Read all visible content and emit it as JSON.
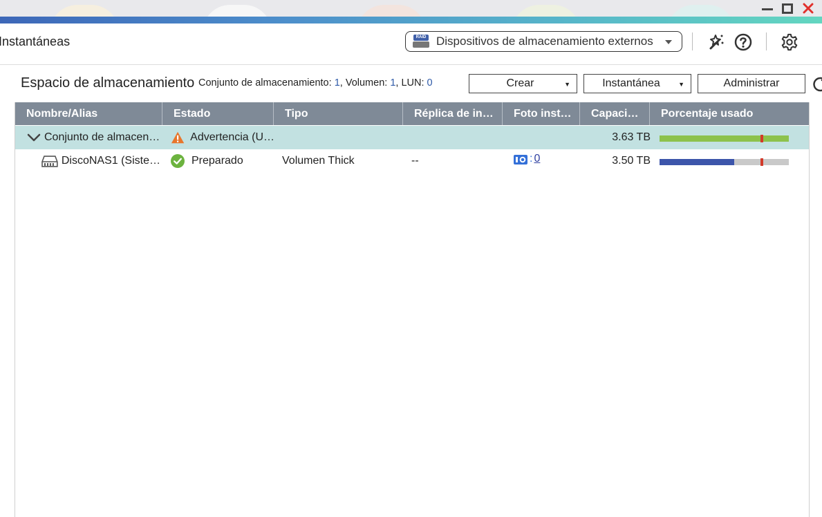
{
  "window": {
    "title": "Instantáneas",
    "controls": [
      "minimize-icon",
      "maximize-icon",
      "close-icon"
    ]
  },
  "header": {
    "device_button_label": "Dispositivos de almacenamiento externos",
    "device_icon_badge": "RAID",
    "icons": [
      "magic-wand-icon",
      "help-icon",
      "gear-icon"
    ]
  },
  "storage": {
    "title": "Espacio de almacenamiento",
    "pool_label": "Conjunto de almacenamiento:",
    "pool_count": "1",
    "volume_label": "Volumen:",
    "volume_count": "1",
    "lun_label": "LUN:",
    "lun_count": "0",
    "buttons": {
      "create": "Crear",
      "snapshot": "Instantánea",
      "manage": "Administrar"
    }
  },
  "table": {
    "columns": [
      "Nombre/Alias",
      "Estado",
      "Tipo",
      "Réplica de in…",
      "Foto inst…",
      "Capaci…",
      "Porcentaje usado"
    ],
    "rows": [
      {
        "name": "Conjunto de almacen…",
        "status": "Advertencia (U…",
        "type": "",
        "replica": "",
        "snapshot": "",
        "capacity": "3.63 TB",
        "usage_percent": 100,
        "threshold_percent": 79,
        "bar_color": "#8dc24c"
      },
      {
        "name": "DiscoNAS1 (Siste…",
        "status": "Preparado",
        "type": "Volumen Thick",
        "replica": "--",
        "snapshot_count": "0",
        "capacity": "3.50 TB",
        "usage_percent": 58,
        "threshold_percent": 79,
        "bar_color": "#3c55aa"
      }
    ]
  },
  "colors": {
    "header_row": "#7f8a97",
    "selected_row": "#c2e1e1",
    "warning": "#e8762c",
    "ok": "#6cb33f",
    "accent": "#2f5aa8"
  }
}
